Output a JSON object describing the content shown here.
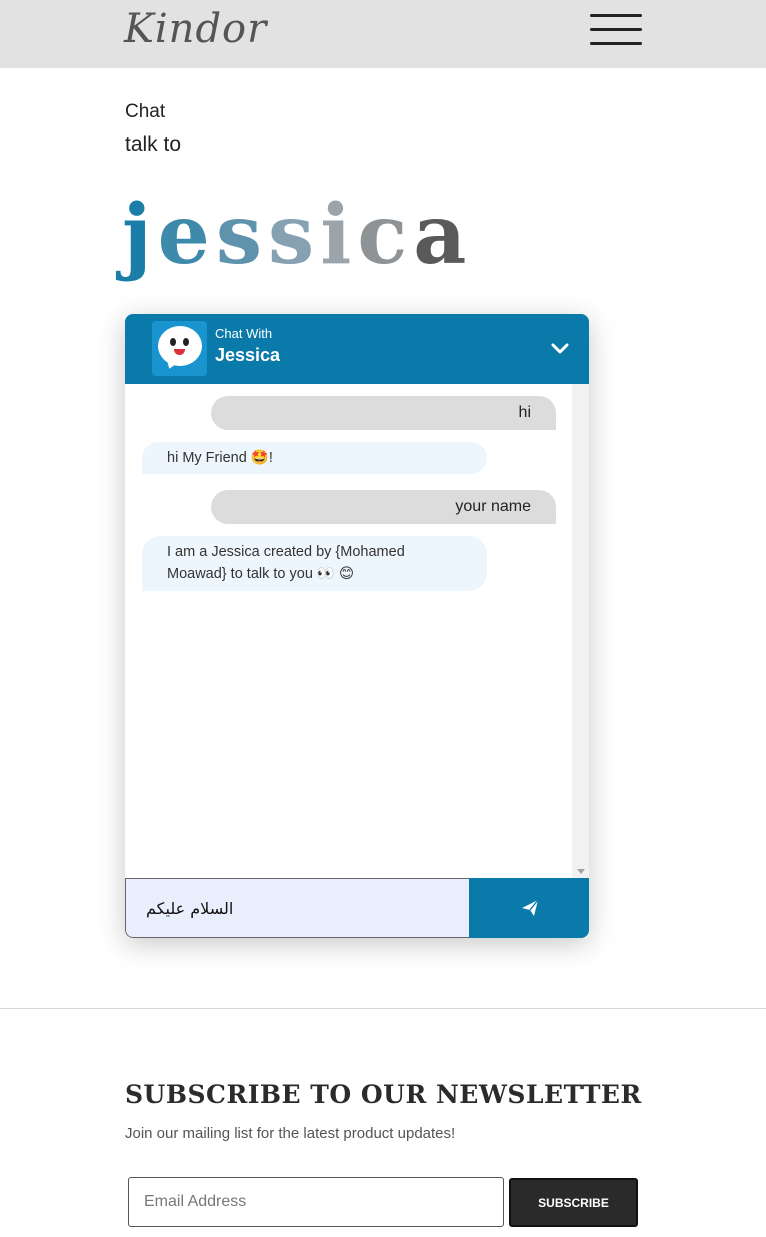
{
  "header": {
    "logo": "Kindor",
    "menu_icon": "hamburger-menu-icon"
  },
  "intro": {
    "label": "Chat",
    "subtitle": "talk to",
    "bot_name_letters": [
      "j",
      "e",
      "s",
      "s",
      "i",
      "c",
      "a"
    ],
    "bot_name_colors": [
      "#1a7ea8",
      "#3e8aaa",
      "#5f93ad",
      "#86a2b2",
      "#9aa4aa",
      "#8f9396",
      "#5a5a5a"
    ]
  },
  "chat": {
    "header_small": "Chat With",
    "header_name": "Jessica",
    "avatar_icon": "chat-bubble-face-icon",
    "collapse_icon": "chevron-down-icon",
    "messages": [
      {
        "from": "user",
        "text": "hi"
      },
      {
        "from": "bot",
        "text": "hi My Friend 🤩!"
      },
      {
        "from": "user",
        "text": "your name"
      },
      {
        "from": "bot",
        "text": "I am a Jessica created by {Mohamed Moawad} to talk to you 👀 😊"
      }
    ],
    "input_value": "السلام عليكم",
    "send_icon": "paper-plane-icon",
    "accent": "#0a7aaa"
  },
  "newsletter": {
    "title": "SUBSCRIBE TO OUR NEWSLETTER",
    "description": "Join our mailing list for the latest product updates!",
    "email_placeholder": "Email Address",
    "button_label": "SUBSCRIBE"
  }
}
